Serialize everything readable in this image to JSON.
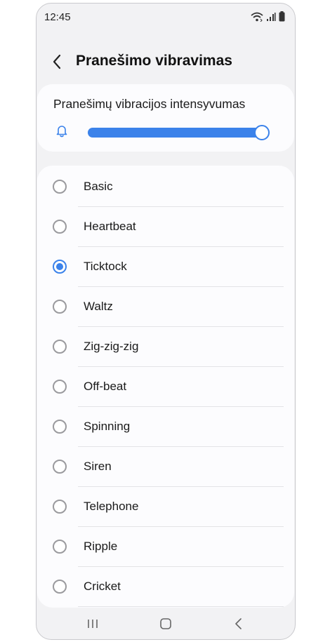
{
  "status_bar": {
    "time": "12:45"
  },
  "header": {
    "title": "Pranešimo vibravimas"
  },
  "intensity": {
    "label": "Pranešimų vibracijos intensyvumas",
    "level_percent": 100
  },
  "patterns": [
    {
      "label": "Basic",
      "selected": false
    },
    {
      "label": "Heartbeat",
      "selected": false
    },
    {
      "label": "Ticktock",
      "selected": true
    },
    {
      "label": "Waltz",
      "selected": false
    },
    {
      "label": "Zig-zig-zig",
      "selected": false
    },
    {
      "label": "Off-beat",
      "selected": false
    },
    {
      "label": "Spinning",
      "selected": false
    },
    {
      "label": "Siren",
      "selected": false
    },
    {
      "label": "Telephone",
      "selected": false
    },
    {
      "label": "Ripple",
      "selected": false
    },
    {
      "label": "Cricket",
      "selected": false
    }
  ],
  "colors": {
    "accent": "#3b82ea",
    "background": "#f2f2f4",
    "card": "#fcfcfe"
  },
  "icons": [
    "wifi-icon",
    "signal-icon",
    "battery-icon",
    "back-arrow-icon",
    "bell-icon",
    "recents-icon",
    "home-icon",
    "nav-back-icon"
  ]
}
